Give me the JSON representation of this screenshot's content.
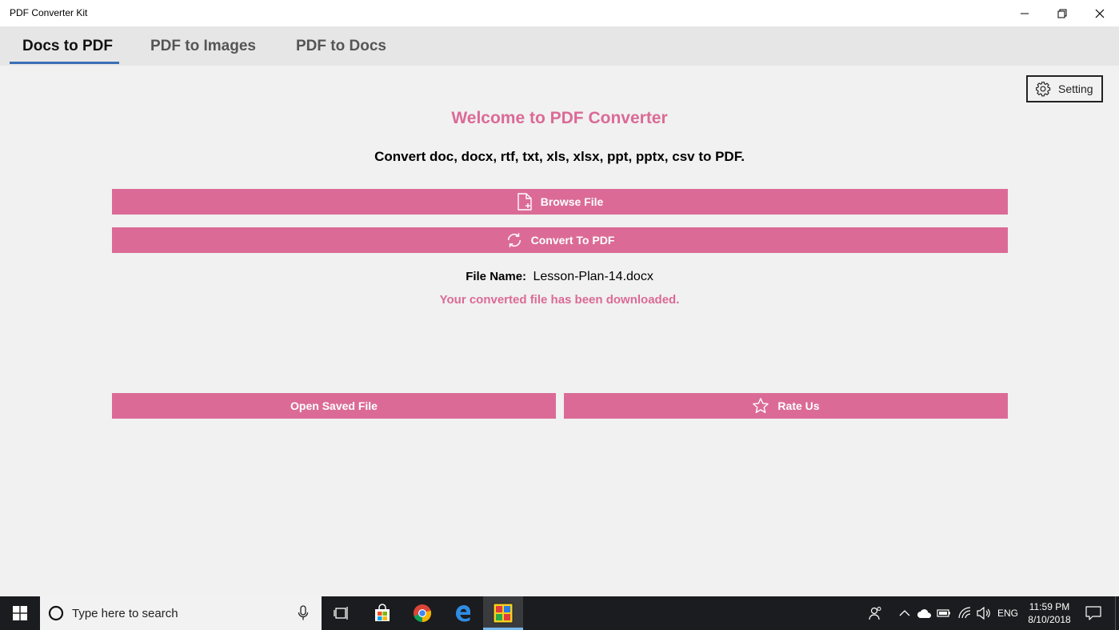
{
  "window": {
    "title": "PDF Converter Kit",
    "minimize_icon": "minimize-icon",
    "restore_icon": "restore-icon",
    "close_icon": "close-icon"
  },
  "tabs": [
    {
      "label": "Docs to PDF",
      "active": true
    },
    {
      "label": "PDF to Images",
      "active": false
    },
    {
      "label": "PDF to Docs",
      "active": false
    }
  ],
  "setting": {
    "label": "Setting",
    "icon": "gear-icon"
  },
  "main": {
    "welcome": "Welcome to PDF Converter",
    "subtitle": "Convert doc, docx, rtf, txt, xls, xlsx, ppt, pptx, csv to PDF.",
    "browse_label": "Browse File",
    "convert_label": "Convert To PDF",
    "file_name_label": "File Name:",
    "file_name_value": "Lesson-Plan-14.docx",
    "status": "Your converted file has been downloaded.",
    "open_saved_label": "Open Saved File",
    "rate_label": "Rate Us"
  },
  "taskbar": {
    "search_placeholder": "Type here to search",
    "language": "ENG",
    "time": "11:59 PM",
    "date": "8/10/2018"
  },
  "colors": {
    "accent_pink": "#db6b96",
    "tab_underline": "#3b6fb6",
    "taskbar": "#1b1c1f"
  }
}
